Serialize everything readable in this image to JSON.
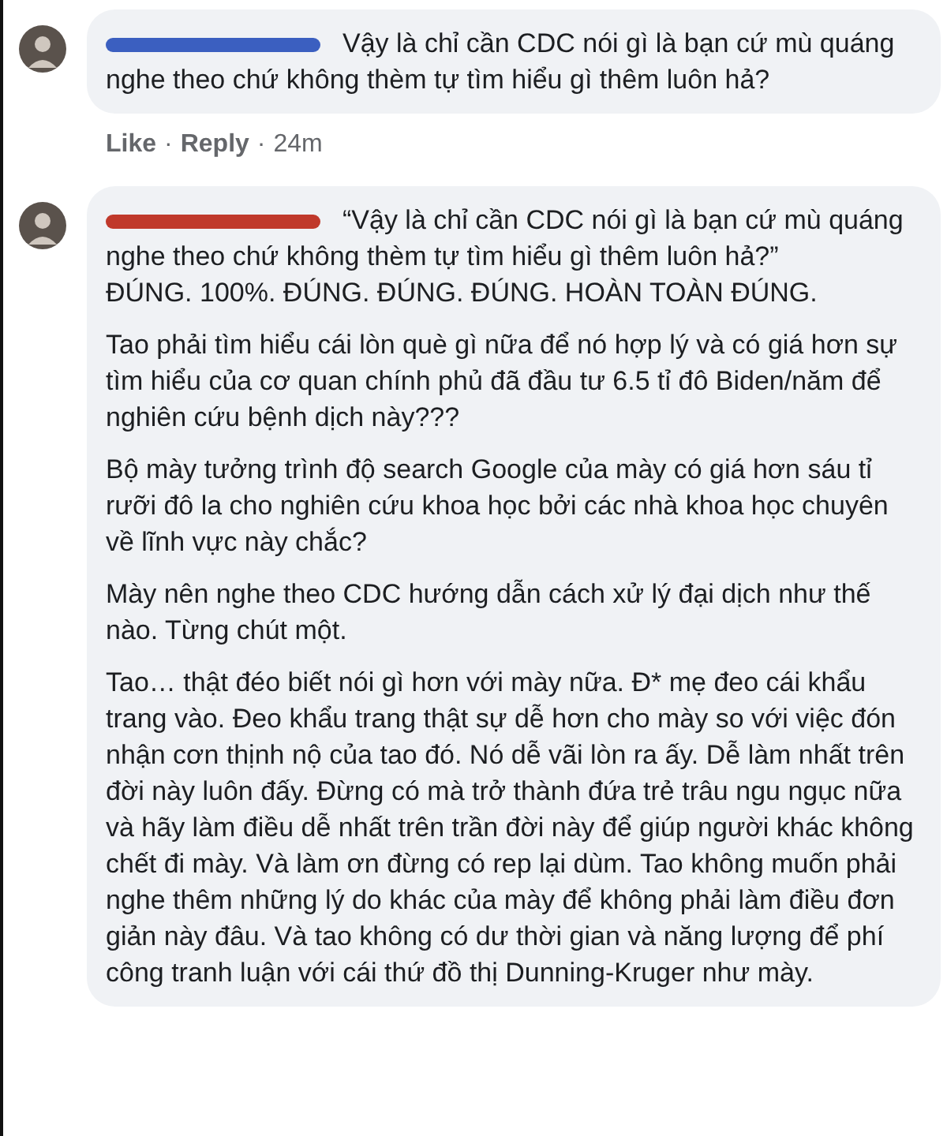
{
  "comments": [
    {
      "color": "#3b5fc0",
      "paragraphs": [
        "Vậy là chỉ cần CDC nói gì là bạn cứ mù quáng nghe theo chứ không thèm tự tìm hiểu gì thêm luôn hả?"
      ],
      "actions": [
        "Like",
        "Reply"
      ],
      "separator": "·",
      "time": "24m"
    },
    {
      "color": "#c0392b",
      "paragraphs": [
        "“Vậy là chỉ cần CDC nói gì là bạn cứ mù quáng nghe theo chứ không thèm tự tìm hiểu gì thêm luôn hả?”\nĐÚNG. 100%. ĐÚNG. ĐÚNG. ĐÚNG. HOÀN TOÀN ĐÚNG.",
        "Tao phải tìm hiểu cái lòn què gì nữa để nó hợp lý và có giá hơn sự tìm hiểu của cơ quan chính phủ đã đầu tư 6.5 tỉ đô Biden/năm để nghiên cứu bệnh dịch này???",
        "Bộ mày tưởng trình độ search Google của mày có giá hơn sáu tỉ rưỡi đô la cho nghiên cứu khoa học bởi các nhà khoa học chuyên về lĩnh vực này chắc?",
        "Mày nên nghe theo CDC hướng dẫn cách xử lý đại dịch như thế nào. Từng chút một.",
        "Tao… thật đéo biết nói gì hơn với mày nữa. Đ* mẹ đeo cái khẩu trang vào. Đeo khẩu trang thật sự dễ hơn cho mày so với việc đón nhận cơn thịnh nộ của tao đó. Nó dễ vãi lòn ra ấy. Dễ làm nhất trên đời này luôn đấy. Đừng có mà trở thành đứa trẻ trâu ngu ngục nữa và hãy làm điều dễ nhất trên trần đời này để giúp người khác không chết đi mày. Và làm ơn đừng có rep lại dùm. Tao không muốn phải nghe thêm những lý do khác của mày để không phải làm điều đơn giản này đâu. Và tao không có dư thời gian và năng lượng để phí công tranh luận với cái thứ đồ thị Dunning-Kruger như mày."
      ]
    }
  ]
}
